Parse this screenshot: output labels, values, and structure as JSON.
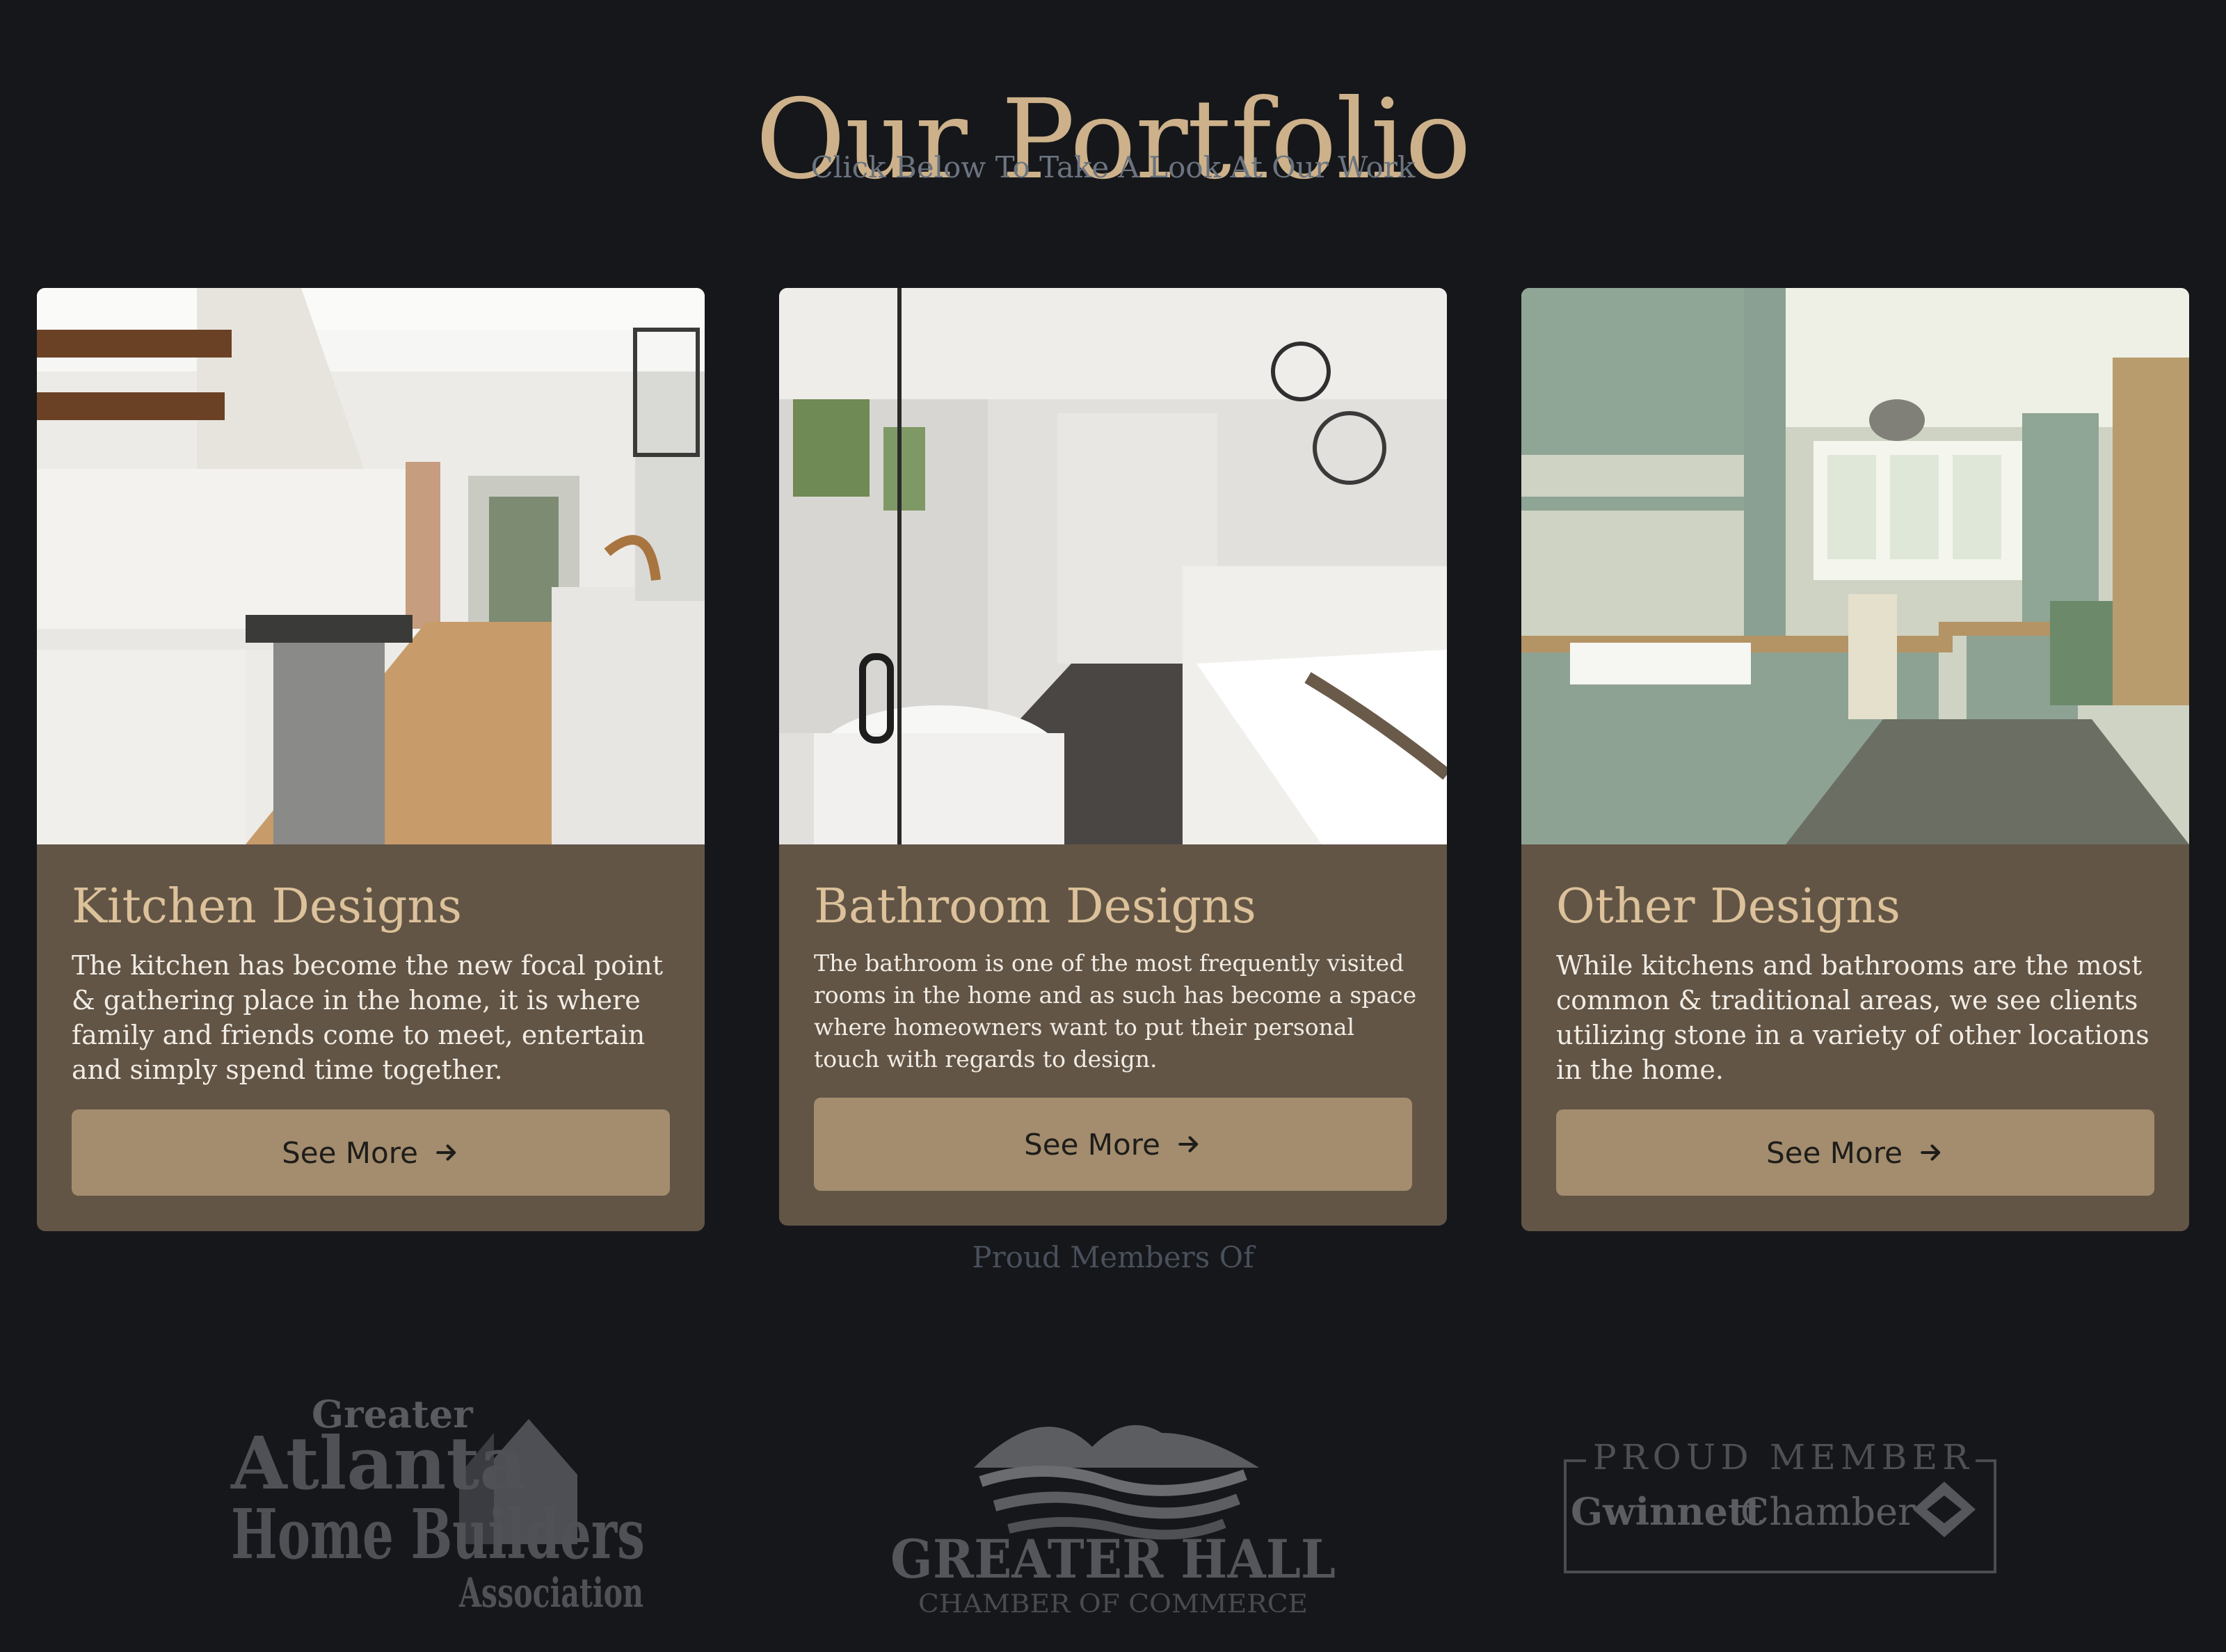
{
  "header": {
    "title": "Our Portfolio",
    "subtitle": "Click Below To Take A Look At Our Work"
  },
  "cards": [
    {
      "title": "Kitchen Designs",
      "text": "The kitchen has become the new focal point & gathering place in the home, it is where family and friends come to meet, entertain and simply spend time together.",
      "button_label": "See More",
      "image": "kitchen-photo"
    },
    {
      "title": "Bathroom Designs",
      "text": "The bathroom is one of the most frequently visited rooms in the home and as such has become a space where homeowners want to put their personal touch with regards to design.",
      "button_label": "See More",
      "image": "bathroom-photo"
    },
    {
      "title": "Other Designs",
      "text": "While kitchens and bathrooms are the most common & traditional areas, we see clients utilizing stone in a variety of other locations in the home.",
      "button_label": "See More",
      "image": "laundry-office-photo"
    }
  ],
  "members": {
    "title": "Proud Members Of",
    "logos": [
      {
        "name": "ahba-logo",
        "lines": [
          "Greater",
          "Atlanta",
          "Home Builders",
          "Association"
        ]
      },
      {
        "name": "greater-hall-logo",
        "lines": [
          "GREATER HALL",
          "CHAMBER OF COMMERCE"
        ]
      },
      {
        "name": "gwinnett-logo",
        "lines": [
          "PROUD MEMBER",
          "Gwinnett",
          "Chamber"
        ]
      }
    ]
  },
  "colors": {
    "background": "#16171a",
    "title": "#cdb18a",
    "card": "#625546",
    "button": "#a38d6e"
  }
}
